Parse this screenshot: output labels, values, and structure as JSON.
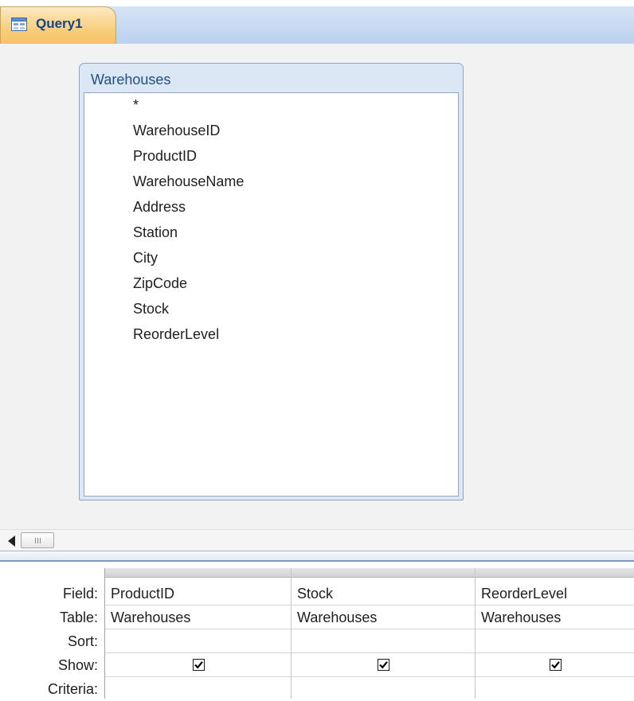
{
  "tab": {
    "label": "Query1",
    "icon": "query-design-icon"
  },
  "table": {
    "title": "Warehouses",
    "fields": [
      "*",
      "WarehouseID",
      "ProductID",
      "WarehouseName",
      "Address",
      "Station",
      "City",
      "ZipCode",
      "Stock",
      "ReorderLevel"
    ]
  },
  "grid": {
    "row_labels": {
      "field": "Field:",
      "table": "Table:",
      "sort": "Sort:",
      "show": "Show:",
      "criteria": "Criteria:"
    },
    "columns": [
      {
        "field": "ProductID",
        "table": "Warehouses",
        "sort": "",
        "show": true,
        "criteria": ""
      },
      {
        "field": "Stock",
        "table": "Warehouses",
        "sort": "",
        "show": true,
        "criteria": ""
      },
      {
        "field": "ReorderLevel",
        "table": "Warehouses",
        "sort": "",
        "show": true,
        "criteria": ""
      }
    ]
  },
  "colors": {
    "tab_active": "#f8cf7e",
    "tab_bar": "#c9daf1",
    "table_title": "#1f4e84",
    "canvas": "#f2f2f2"
  }
}
